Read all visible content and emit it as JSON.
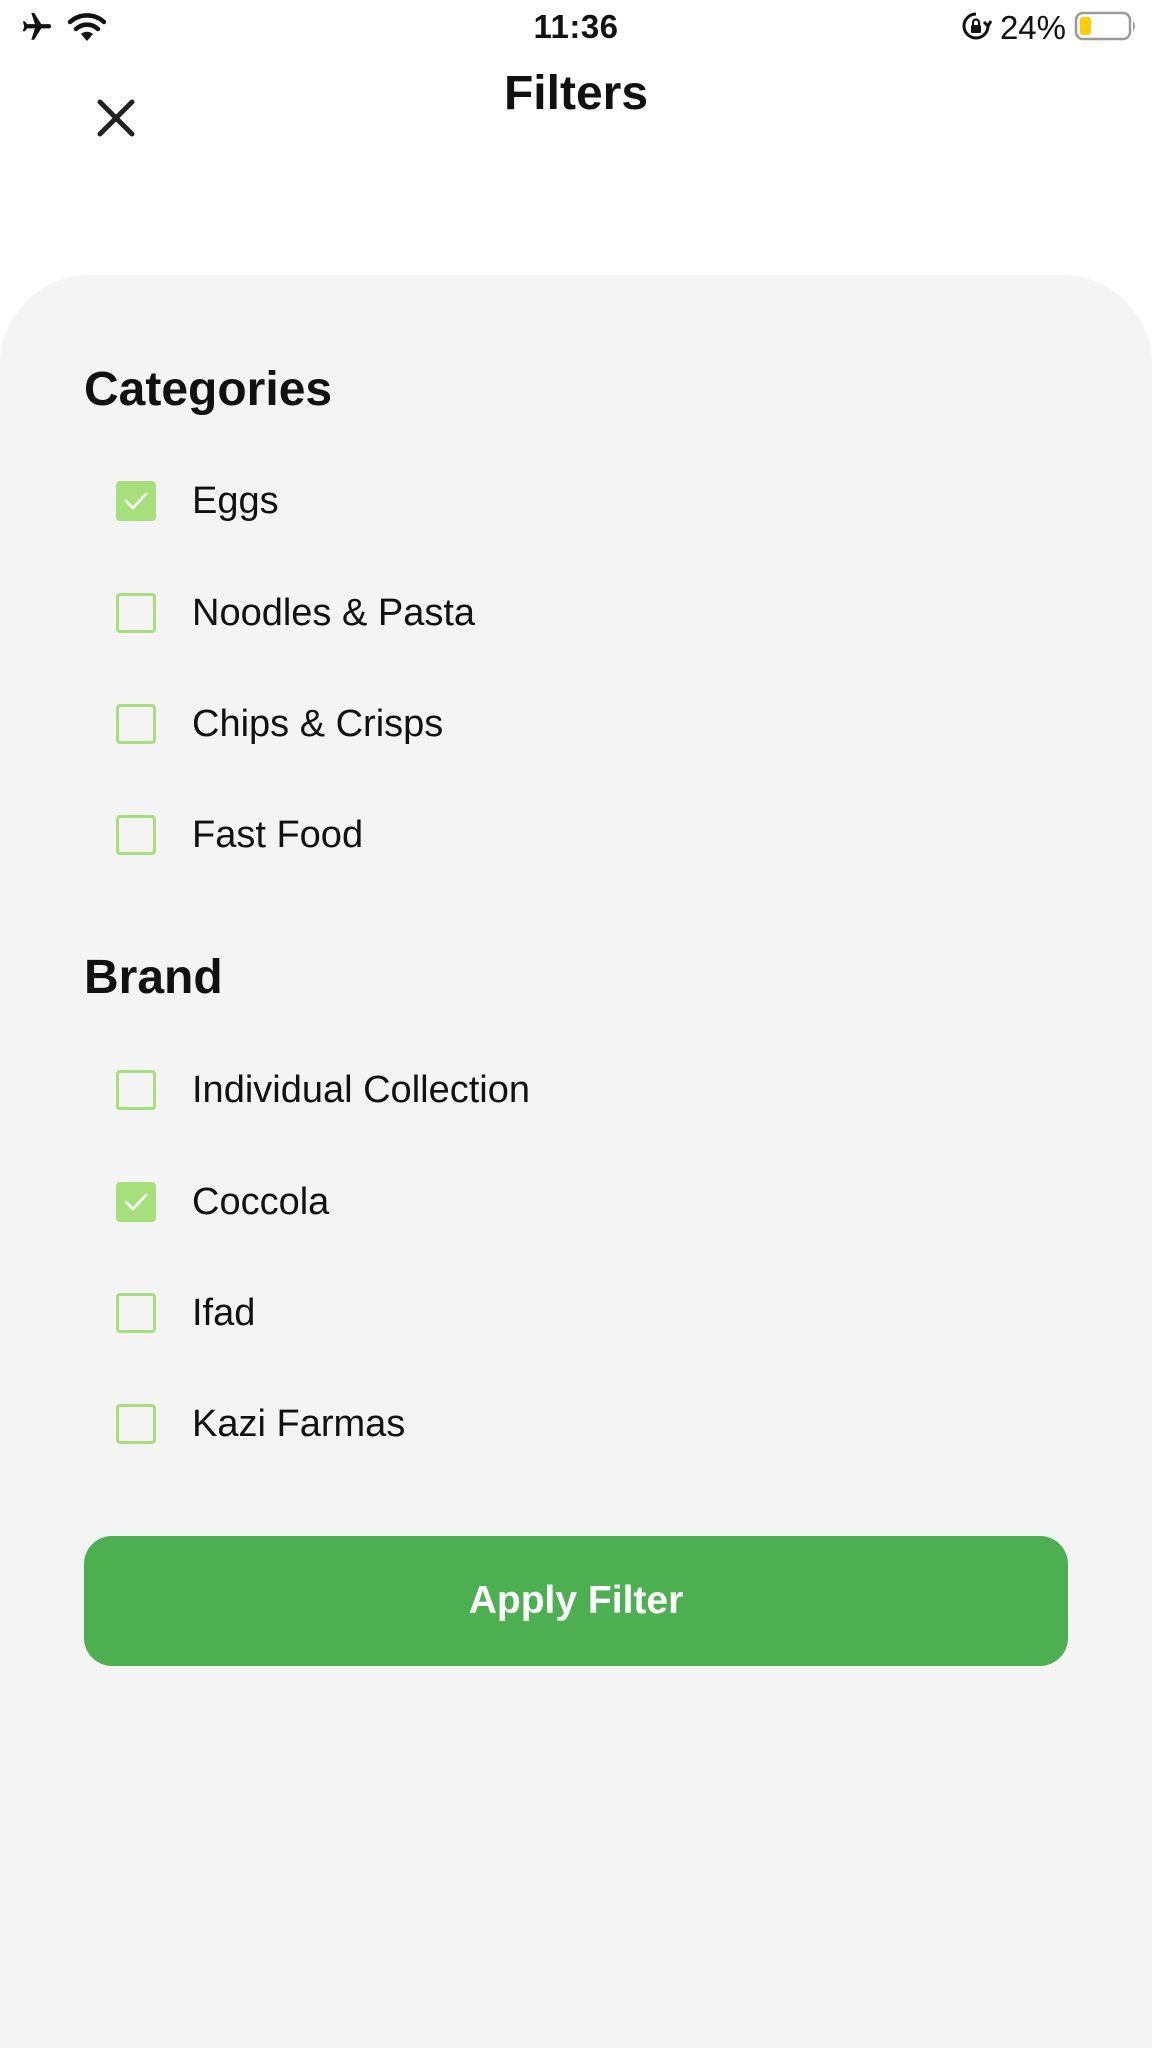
{
  "status_bar": {
    "time": "11:36",
    "battery_percent": "24%",
    "icons": [
      "airplane-icon",
      "wifi-icon",
      "orientation-lock-icon",
      "battery-icon"
    ],
    "battery_level": 0.24,
    "battery_color": "#ffcc00"
  },
  "header": {
    "title": "Filters",
    "close_icon": "close-icon"
  },
  "filters": {
    "categories": {
      "heading": "Categories",
      "options": [
        {
          "label": "Eggs",
          "checked": true
        },
        {
          "label": "Noodles & Pasta",
          "checked": false
        },
        {
          "label": "Chips & Crisps",
          "checked": false
        },
        {
          "label": "Fast Food",
          "checked": false
        }
      ]
    },
    "brand": {
      "heading": "Brand",
      "options": [
        {
          "label": "Individual Collection",
          "checked": false
        },
        {
          "label": "Coccola",
          "checked": true
        },
        {
          "label": "Ifad",
          "checked": false
        },
        {
          "label": "Kazi Farmas",
          "checked": false
        }
      ]
    }
  },
  "apply_button": {
    "label": "Apply Filter"
  },
  "colors": {
    "accent": "#4caf50",
    "checkbox": "#a6e07a",
    "sheet_background": "#f4f4f4"
  }
}
